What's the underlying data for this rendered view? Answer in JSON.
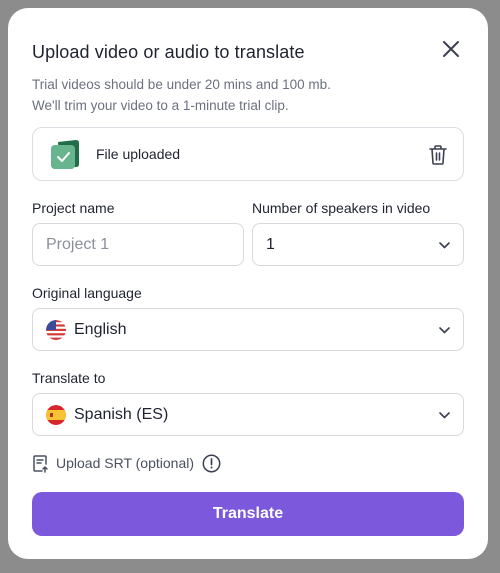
{
  "modal": {
    "title": "Upload video or audio to translate",
    "subtitle_line1": "Trial videos should be under 20 mins and 100 mb.",
    "subtitle_line2": "We'll trim your video to a 1-minute trial clip."
  },
  "file": {
    "status": "File uploaded",
    "icon": "file-check-icon"
  },
  "project_name": {
    "label": "Project name",
    "placeholder": "Project 1",
    "value": ""
  },
  "speakers": {
    "label": "Number of speakers in video",
    "value": "1"
  },
  "original_language": {
    "label": "Original language",
    "value": "English",
    "flag": "us-flag-icon"
  },
  "translate_to": {
    "label": "Translate to",
    "value": "Spanish (ES)",
    "flag": "es-flag-icon"
  },
  "srt": {
    "label": "Upload SRT (optional)"
  },
  "actions": {
    "translate_label": "Translate"
  },
  "colors": {
    "accent": "#7c58dc",
    "file_icon_green": "#2f8a5b",
    "border": "#d7d9df"
  }
}
